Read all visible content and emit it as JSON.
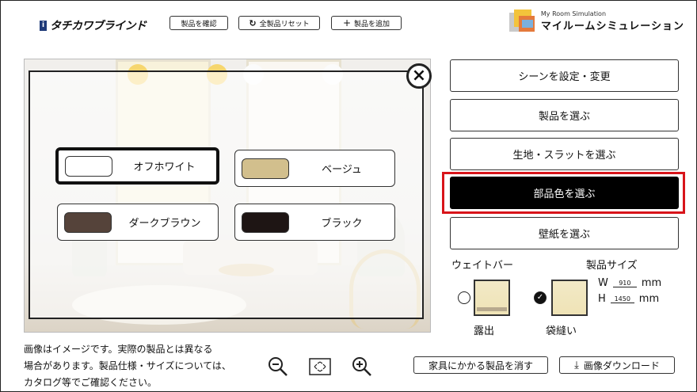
{
  "header": {
    "logo_text": "タチカワブラインド",
    "confirm_label": "製品を確認",
    "reset_label": "全製品リセット",
    "add_label": "製品を追加",
    "brand_sub": "My Room Simulation",
    "brand_main": "マイルームシミュレーション"
  },
  "colors": {
    "title": "部品色",
    "options": [
      {
        "label": "オフホワイト",
        "color": "#ffffff",
        "selected": true
      },
      {
        "label": "ベージュ",
        "color": "#d2bf8d",
        "selected": false
      },
      {
        "label": "ダークブラウン",
        "color": "#55433a",
        "selected": false
      },
      {
        "label": "ブラック",
        "color": "#1e1514",
        "selected": false
      }
    ]
  },
  "menu": {
    "scene": "シーンを設定・変更",
    "product": "製品を選ぶ",
    "fabric": "生地・スラットを選ぶ",
    "parts_color": "部品色を選ぶ",
    "wallpaper": "壁紙を選ぶ"
  },
  "options": {
    "weight_bar_label": "ウェイトバー",
    "size_label": "製品サイズ",
    "exposed_label": "露出",
    "pocket_label": "袋縫い",
    "width_prefix": "W",
    "width_value": "910",
    "height_prefix": "H",
    "height_value": "1450",
    "unit": "mm"
  },
  "footer": {
    "note_line1": "画像はイメージです。実際の製品とは異なる",
    "note_line2": "場合があります。製品仕様・サイズについては、",
    "note_line3": "カタログ等でご確認ください。",
    "remove_furniture_label": "家具にかかる製品を消す",
    "download_label": "画像ダウンロード"
  },
  "accent": {
    "highlight": "#d8141a",
    "active_bg": "#000000"
  }
}
